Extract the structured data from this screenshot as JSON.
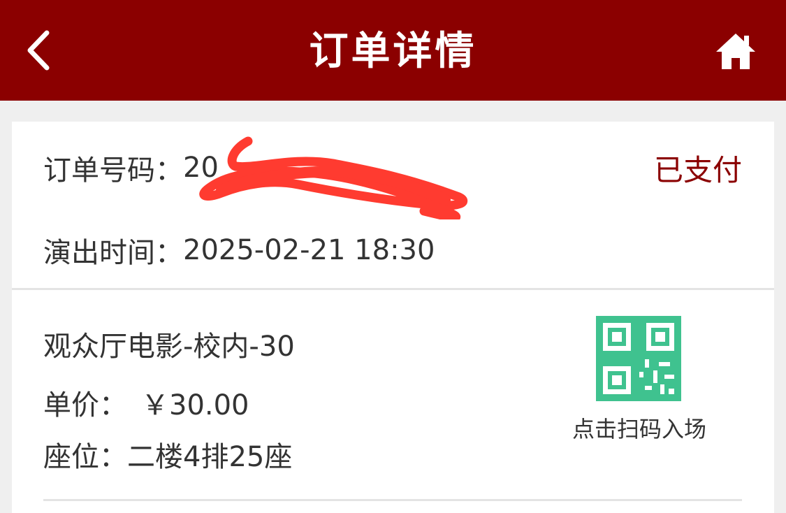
{
  "header": {
    "title": "订单详情",
    "bg_color": "#8b0000",
    "back_icon": "chevron-left-icon",
    "home_icon": "home-icon"
  },
  "order": {
    "number_label": "订单号码：",
    "number_value": "20",
    "status": "已支付",
    "status_color": "#8b0000",
    "time_label": "演出时间：",
    "time_value": "2025-02-21 18:30"
  },
  "item": {
    "title": "观众厅电影-校内-30",
    "price_label": "单价：",
    "price_value": "￥30.00",
    "seat_label": "座位：",
    "seat_value": "二楼4排25座",
    "qr_icon": "qr-code-icon",
    "qr_color": "#3fc28f",
    "qr_hint": "点击扫码入场"
  },
  "redaction_color": "#ff3b30"
}
